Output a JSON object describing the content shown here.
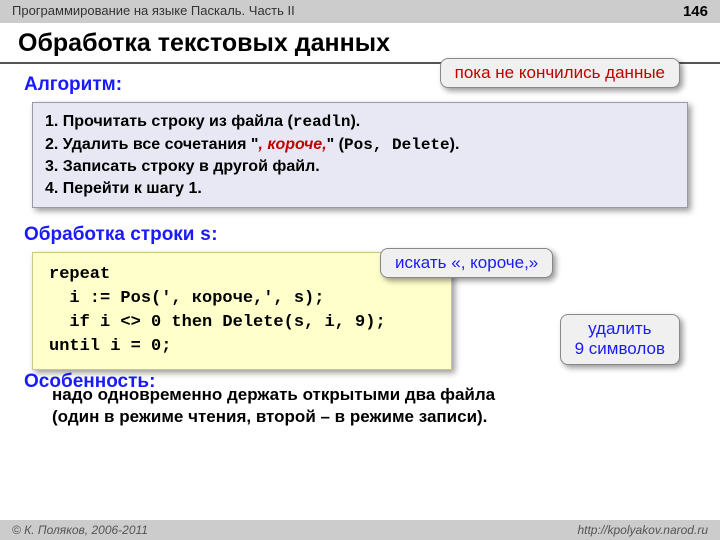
{
  "header": {
    "course": "Программирование на языке Паскаль. Часть II",
    "page": "146"
  },
  "title": "Обработка текстовых данных",
  "sections": {
    "algorithm_head": "Алгоритм:",
    "string_head": "Обработка строки s:",
    "feature_head_hidden": "Особенность:"
  },
  "algo": {
    "line1a": "1. Прочитать строку из файла (",
    "line1b": "readln",
    "line1c": ").",
    "line2a": "2. Удалить все сочетания \"",
    "line2b": ", короче,",
    "line2c": "\" (",
    "line2d": "Pos, Delete",
    "line2e": ").",
    "line3": "3. Записать строку в другой файл.",
    "line4": "4. Перейти к шагу 1."
  },
  "code": {
    "l1": "repeat",
    "l2": "  i := Pos(', короче,', s);",
    "l3": "  if i <> 0 then Delete(s, i, 9);",
    "l4": "until i = 0;"
  },
  "callouts": {
    "top": "пока не кончились данные",
    "mid": "искать «, короче,»",
    "right_l1": "удалить",
    "right_l2": "9 символов"
  },
  "feature_text_l1": "надо одновременно держать открытыми два файла",
  "feature_text_l2": "(один в режиме чтения, второй – в режиме записи).",
  "footer": {
    "left": "© К. Поляков, 2006-2011",
    "right": "http://kpolyakov.narod.ru"
  }
}
